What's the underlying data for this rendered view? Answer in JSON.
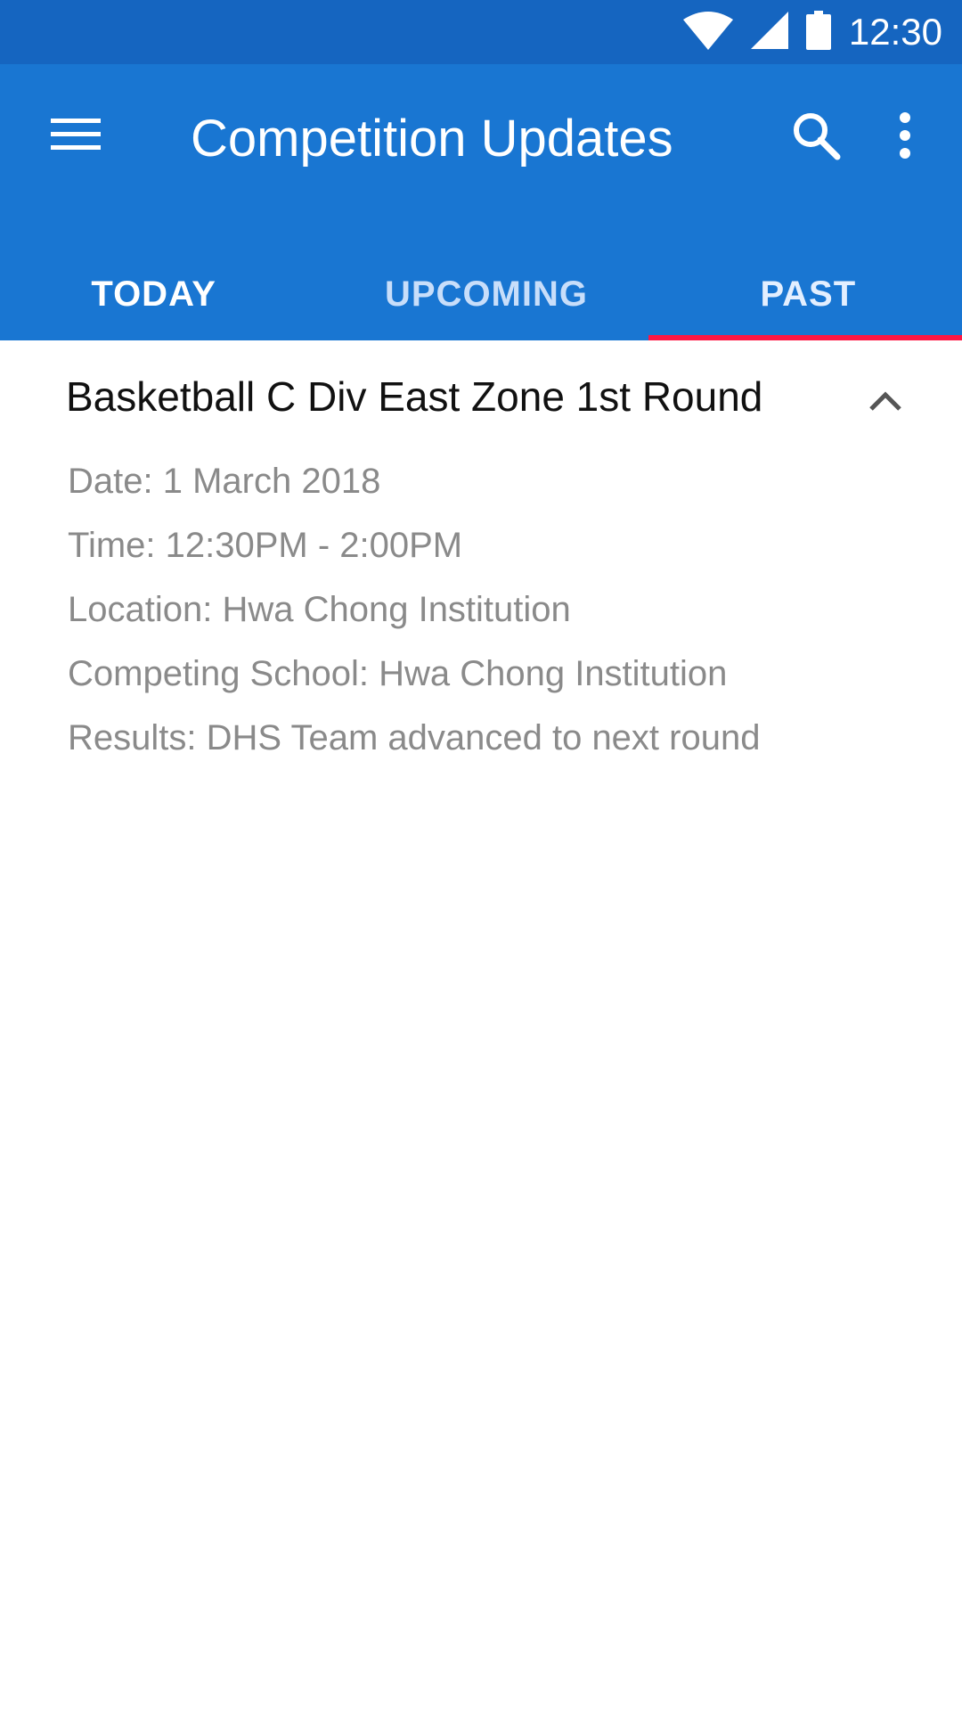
{
  "status_bar": {
    "time": "12:30",
    "icons": [
      "wifi-icon",
      "signal-icon",
      "battery-icon"
    ]
  },
  "app_bar": {
    "title": "Competition Updates",
    "menu_icon": "menu-icon",
    "search_icon": "search-icon",
    "more_icon": "more-vert-icon",
    "color": "#1976d2",
    "status_color": "#1565c0"
  },
  "tabs": [
    {
      "label": "TODAY"
    },
    {
      "label": "UPCOMING"
    },
    {
      "label": "PAST"
    }
  ],
  "selected_tab": "PAST",
  "indicator_color": "#ff1744",
  "competition": {
    "title": "Basketball C Div East Zone 1st Round",
    "expanded": true,
    "details": [
      "Date: 1 March 2018",
      "Time: 12:30PM - 2:00PM",
      "Location: Hwa Chong Institution",
      "Competing School: Hwa Chong Institution",
      "Results: DHS Team advanced to next round"
    ]
  }
}
